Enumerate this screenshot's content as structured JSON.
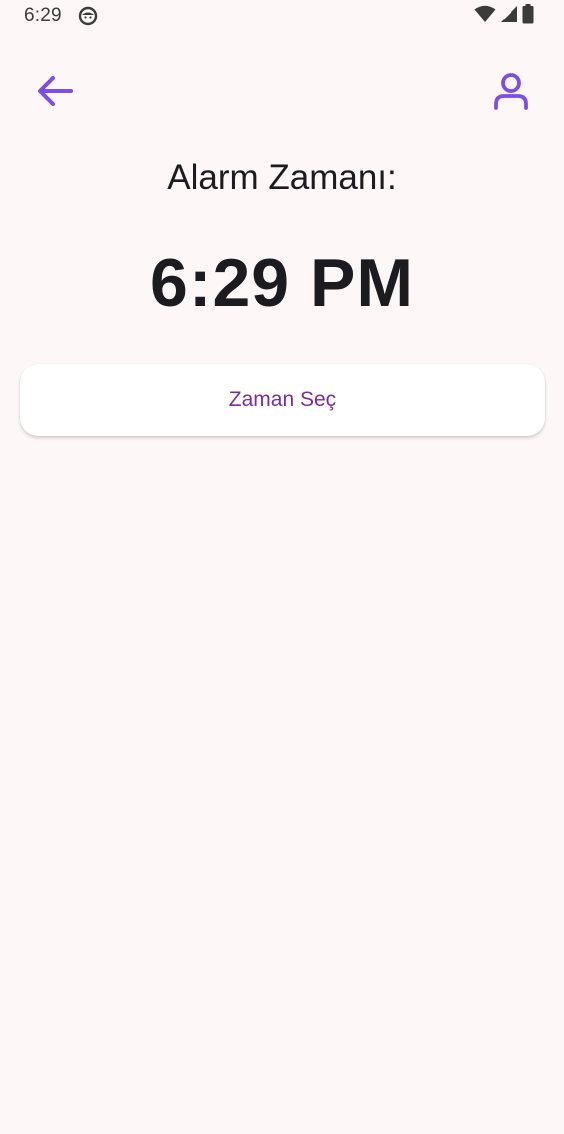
{
  "status_bar": {
    "time": "6:29",
    "icons": [
      "notification-face-icon",
      "wifi-icon",
      "signal-icon",
      "battery-icon"
    ]
  },
  "app_bar": {
    "back_icon": "arrow-left-icon",
    "profile_icon": "person-icon"
  },
  "main": {
    "alarm_label": "Alarm Zamanı:",
    "alarm_time": "6:29 PM",
    "pick_time_button": "Zaman Seç"
  },
  "colors": {
    "background": "#FEF7F7",
    "accent": "#7C4DEB",
    "button_text": "#7B2E98",
    "text": "#1C1B1F"
  }
}
